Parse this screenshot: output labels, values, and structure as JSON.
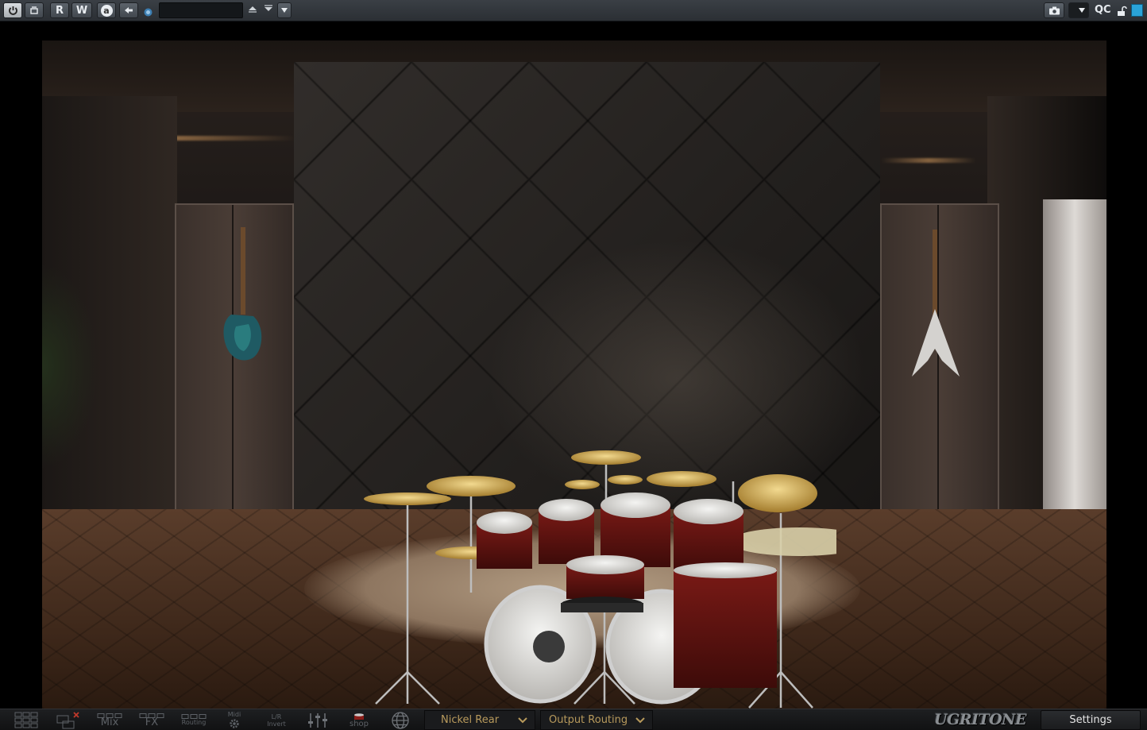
{
  "host_toolbar": {
    "read_label": "R",
    "write_label": "W",
    "auto_label": "a",
    "preset_name": "",
    "qc_label": "QC",
    "icons": [
      "power-icon",
      "bypass-icon",
      "read-automation-icon",
      "write-automation-icon",
      "auto-icon",
      "back-arrow-icon",
      "sync-icon",
      "preset-up-icon",
      "preset-down-icon",
      "preset-menu-icon",
      "camera-icon",
      "dropdown-icon",
      "lock-icon"
    ],
    "accent_color": "#2aa3d8"
  },
  "bottom_bar": {
    "mix_label": "Mix",
    "fx_label": "FX",
    "routing_label": "Routing",
    "midi_label": "Midi",
    "lr_label": "L/R",
    "invert_label": "Invert",
    "shop_label": "shop",
    "cymbal_preset": "Nickel Rear",
    "output_routing": "Output Routing",
    "brand_logo": "UGRITONE",
    "settings_label": "Settings",
    "text_color": "#b89a5c"
  }
}
